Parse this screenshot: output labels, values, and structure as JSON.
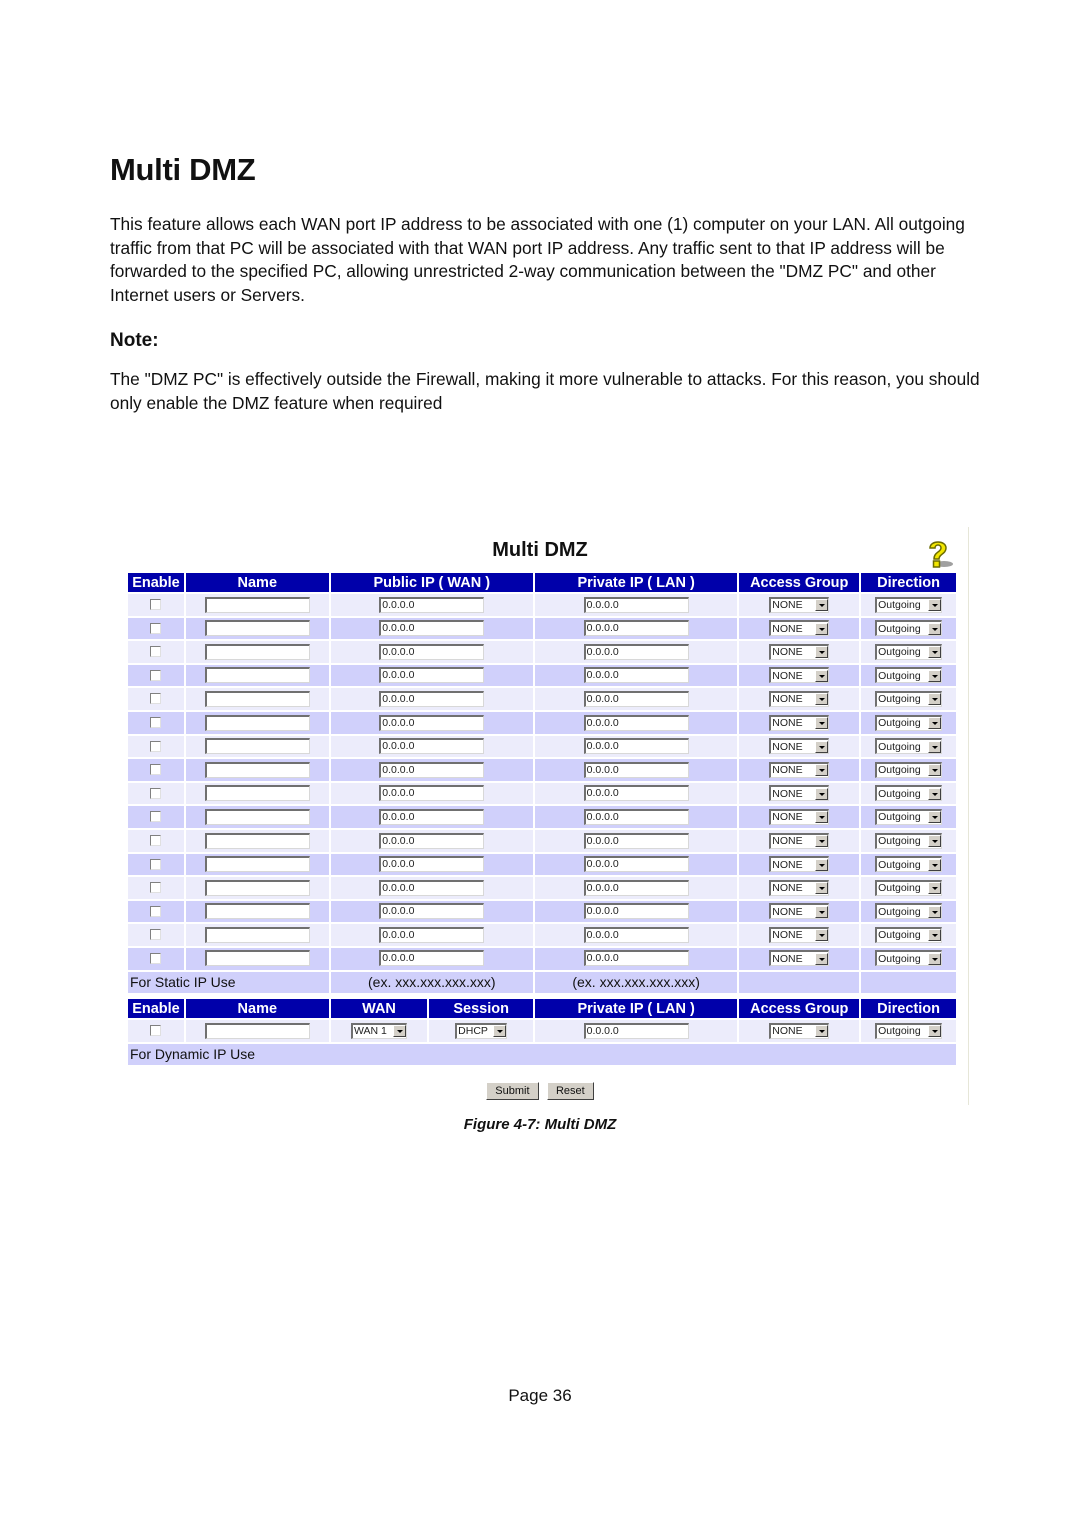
{
  "document": {
    "title": "Multi DMZ",
    "intro": "This feature allows each WAN port IP address to be associated with one (1) computer on your LAN. All outgoing traffic from that PC will be associated with that WAN port IP address. Any traffic sent to that IP address will be forwarded to the specified PC, allowing unrestricted 2-way communication between the \"DMZ PC\" and other Internet users or Servers.",
    "note_heading": "Note:",
    "note_text": "The \"DMZ PC\" is effectively outside the Firewall, making it more vulnerable to attacks. For this reason, you should only enable the DMZ feature when required",
    "caption": "Figure 4-7: Multi DMZ",
    "page_number": "Page 36"
  },
  "screenshot": {
    "title": "Multi DMZ",
    "help_icon": "help-question-icon",
    "static_headers": [
      "Enable",
      "Name",
      "Public IP ( WAN )",
      "Private IP ( LAN )",
      "Access Group",
      "Direction"
    ],
    "static_rows": [
      {
        "enabled": false,
        "name": "",
        "public_ip": "0.0.0.0",
        "private_ip": "0.0.0.0",
        "access_group": "NONE",
        "direction": "Outgoing"
      },
      {
        "enabled": false,
        "name": "",
        "public_ip": "0.0.0.0",
        "private_ip": "0.0.0.0",
        "access_group": "NONE",
        "direction": "Outgoing"
      },
      {
        "enabled": false,
        "name": "",
        "public_ip": "0.0.0.0",
        "private_ip": "0.0.0.0",
        "access_group": "NONE",
        "direction": "Outgoing"
      },
      {
        "enabled": false,
        "name": "",
        "public_ip": "0.0.0.0",
        "private_ip": "0.0.0.0",
        "access_group": "NONE",
        "direction": "Outgoing"
      },
      {
        "enabled": false,
        "name": "",
        "public_ip": "0.0.0.0",
        "private_ip": "0.0.0.0",
        "access_group": "NONE",
        "direction": "Outgoing"
      },
      {
        "enabled": false,
        "name": "",
        "public_ip": "0.0.0.0",
        "private_ip": "0.0.0.0",
        "access_group": "NONE",
        "direction": "Outgoing"
      },
      {
        "enabled": false,
        "name": "",
        "public_ip": "0.0.0.0",
        "private_ip": "0.0.0.0",
        "access_group": "NONE",
        "direction": "Outgoing"
      },
      {
        "enabled": false,
        "name": "",
        "public_ip": "0.0.0.0",
        "private_ip": "0.0.0.0",
        "access_group": "NONE",
        "direction": "Outgoing"
      },
      {
        "enabled": false,
        "name": "",
        "public_ip": "0.0.0.0",
        "private_ip": "0.0.0.0",
        "access_group": "NONE",
        "direction": "Outgoing"
      },
      {
        "enabled": false,
        "name": "",
        "public_ip": "0.0.0.0",
        "private_ip": "0.0.0.0",
        "access_group": "NONE",
        "direction": "Outgoing"
      },
      {
        "enabled": false,
        "name": "",
        "public_ip": "0.0.0.0",
        "private_ip": "0.0.0.0",
        "access_group": "NONE",
        "direction": "Outgoing"
      },
      {
        "enabled": false,
        "name": "",
        "public_ip": "0.0.0.0",
        "private_ip": "0.0.0.0",
        "access_group": "NONE",
        "direction": "Outgoing"
      },
      {
        "enabled": false,
        "name": "",
        "public_ip": "0.0.0.0",
        "private_ip": "0.0.0.0",
        "access_group": "NONE",
        "direction": "Outgoing"
      },
      {
        "enabled": false,
        "name": "",
        "public_ip": "0.0.0.0",
        "private_ip": "0.0.0.0",
        "access_group": "NONE",
        "direction": "Outgoing"
      },
      {
        "enabled": false,
        "name": "",
        "public_ip": "0.0.0.0",
        "private_ip": "0.0.0.0",
        "access_group": "NONE",
        "direction": "Outgoing"
      },
      {
        "enabled": false,
        "name": "",
        "public_ip": "0.0.0.0",
        "private_ip": "0.0.0.0",
        "access_group": "NONE",
        "direction": "Outgoing"
      }
    ],
    "static_footer": {
      "label": "For Static IP Use",
      "example_public": "(ex. xxx.xxx.xxx.xxx)",
      "example_private": "(ex. xxx.xxx.xxx.xxx)"
    },
    "dynamic_headers": [
      "Enable",
      "Name",
      "WAN",
      "Session",
      "Private IP ( LAN )",
      "Access Group",
      "Direction"
    ],
    "dynamic_row": {
      "enabled": false,
      "name": "",
      "wan": "WAN 1",
      "session": "DHCP",
      "private_ip": "0.0.0.0",
      "access_group": "NONE",
      "direction": "Outgoing"
    },
    "dynamic_footer": {
      "label": "For Dynamic IP Use"
    },
    "buttons": {
      "submit": "Submit",
      "reset": "Reset"
    }
  }
}
